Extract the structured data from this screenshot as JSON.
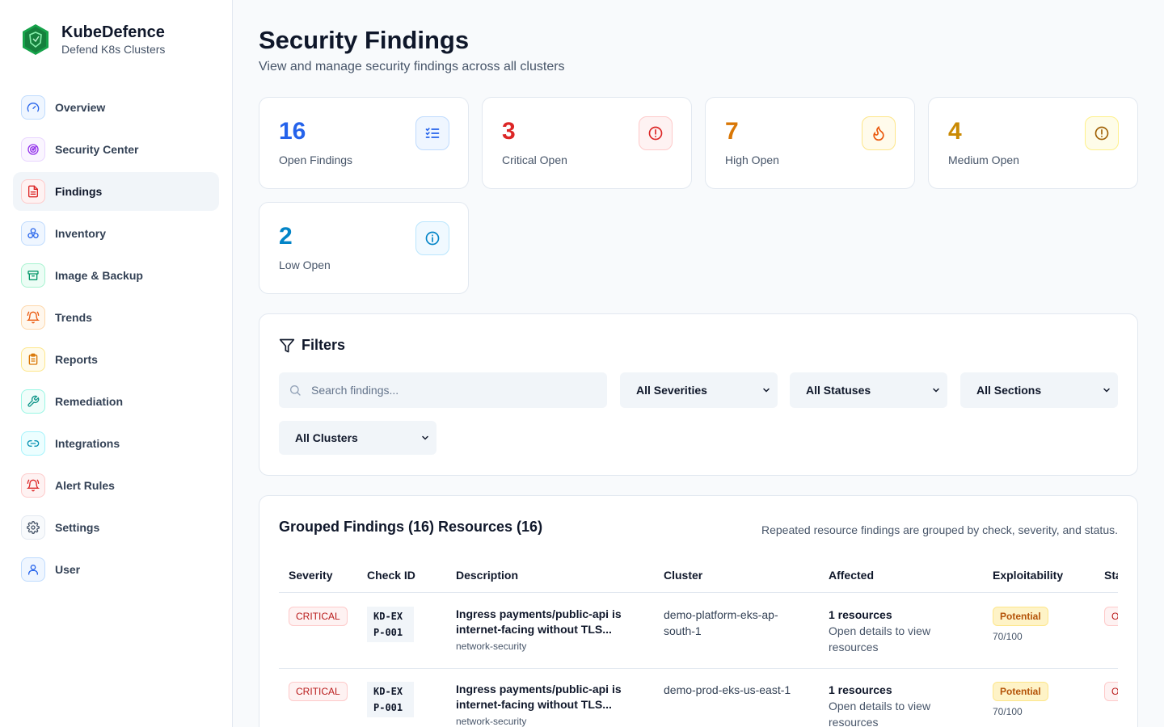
{
  "brand": {
    "name": "KubeDefence",
    "subtitle": "Defend K8s Clusters"
  },
  "sidebar": {
    "items": [
      {
        "label": "Overview",
        "icon": "gauge-icon",
        "color": "#2563eb"
      },
      {
        "label": "Security Center",
        "icon": "radar-icon",
        "color": "#9333ea"
      },
      {
        "label": "Findings",
        "icon": "file-text-icon",
        "color": "#dc2626",
        "active": true
      },
      {
        "label": "Inventory",
        "icon": "boxes-icon",
        "color": "#2563eb"
      },
      {
        "label": "Image & Backup",
        "icon": "archive-icon",
        "color": "#059669"
      },
      {
        "label": "Trends",
        "icon": "bell-ring-icon",
        "color": "#ea580c"
      },
      {
        "label": "Reports",
        "icon": "clipboard-list-icon",
        "color": "#d97706"
      },
      {
        "label": "Remediation",
        "icon": "wrench-icon",
        "color": "#0d9488"
      },
      {
        "label": "Integrations",
        "icon": "link-icon",
        "color": "#0891b2"
      },
      {
        "label": "Alert Rules",
        "icon": "bell-ring-icon",
        "color": "#dc2626"
      },
      {
        "label": "Settings",
        "icon": "gear-icon",
        "color": "#475569"
      },
      {
        "label": "User",
        "icon": "user-icon",
        "color": "#2563eb"
      }
    ]
  },
  "header": {
    "title": "Security Findings",
    "subtitle": "View and manage security findings across all clusters"
  },
  "stats": [
    {
      "value": "16",
      "label": "Open Findings",
      "color": "#2563eb",
      "icon": "list-checks-icon"
    },
    {
      "value": "3",
      "label": "Critical Open",
      "color": "#dc2626",
      "icon": "alert-circle-icon"
    },
    {
      "value": "7",
      "label": "High Open",
      "color": "#d97706",
      "icon": "flame-icon"
    },
    {
      "value": "4",
      "label": "Medium Open",
      "color": "#ca8a04",
      "icon": "alert-circle-icon"
    },
    {
      "value": "2",
      "label": "Low Open",
      "color": "#0284c7",
      "icon": "info-icon"
    }
  ],
  "filters": {
    "title": "Filters",
    "search_placeholder": "Search findings...",
    "severity": "All Severities",
    "status": "All Statuses",
    "section": "All Sections",
    "cluster": "All Clusters"
  },
  "grouped": {
    "title": "Grouped Findings (16) Resources (16)",
    "note": "Repeated resource findings are grouped by check, severity, and status.",
    "columns": [
      "Severity",
      "Check ID",
      "Description",
      "Cluster",
      "Affected",
      "Exploitability",
      "Status"
    ],
    "rows": [
      {
        "severity": "CRITICAL",
        "check_id": "KD-EXP-001",
        "description": "Ingress payments/public-api is internet-facing without TLS...",
        "section": "network-security",
        "cluster": "demo-platform-eks-ap-south-1",
        "affected": "1 resources",
        "affected_sub": "Open details to view resources",
        "exploitability": "Potential",
        "score": "70/100",
        "status": "Open"
      },
      {
        "severity": "CRITICAL",
        "check_id": "KD-EXP-001",
        "description": "Ingress payments/public-api is internet-facing without TLS...",
        "section": "network-security",
        "cluster": "demo-prod-eks-us-east-1",
        "affected": "1 resources",
        "affected_sub": "Open details to view resources",
        "exploitability": "Potential",
        "score": "70/100",
        "status": "Open"
      }
    ]
  }
}
